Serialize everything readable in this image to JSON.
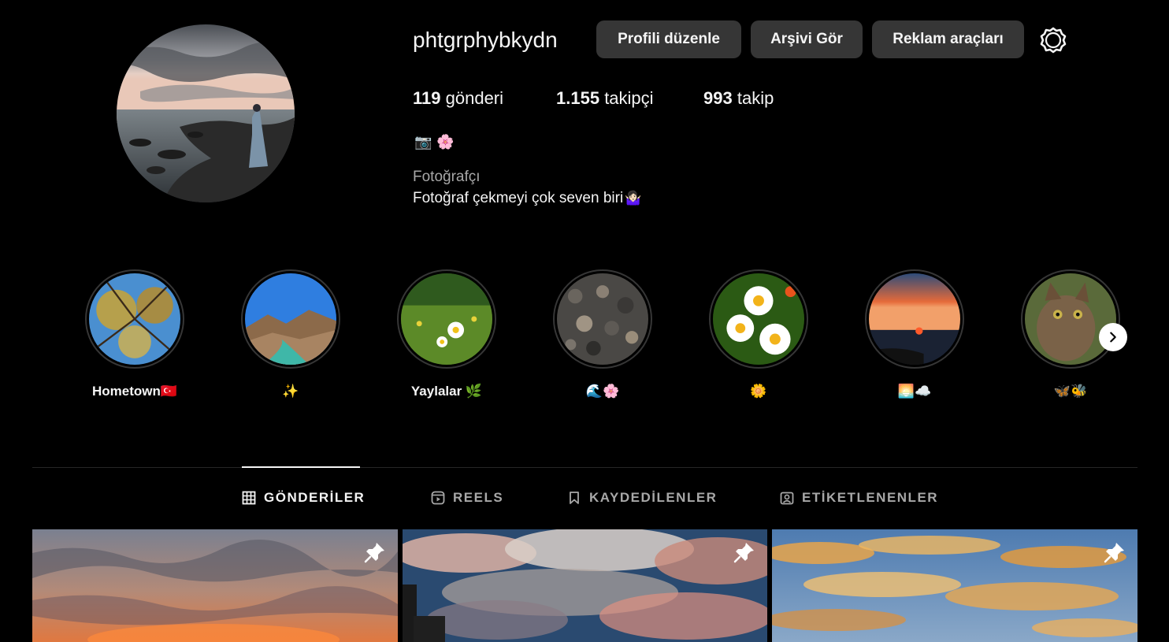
{
  "profile": {
    "username": "phtgrphybkydn",
    "buttons": {
      "edit": "Profili düzenle",
      "archive": "Arşivi Gör",
      "ads": "Reklam araçları"
    },
    "stats": {
      "posts_count": "119",
      "posts_label": "gönderi",
      "followers_count": "1.155",
      "followers_label": "takipçi",
      "following_count": "993",
      "following_label": "takip"
    },
    "bio": {
      "emojis": [
        "📷",
        "🌸"
      ],
      "category": "Fotoğrafçı",
      "text": "Fotoğraf çekmeyi çok seven biri",
      "text_emoji": "🤷🏻‍♀️"
    }
  },
  "highlights": [
    {
      "label": "Hometown🇹🇷",
      "icon": "trees-sky"
    },
    {
      "label": "✨",
      "icon": "mountain-river"
    },
    {
      "label": "Yaylalar 🌿",
      "icon": "meadow-daisies"
    },
    {
      "label": "🌊🌸",
      "icon": "pebbles"
    },
    {
      "label": "🌼",
      "icon": "daisies"
    },
    {
      "label": "🌅☁️",
      "icon": "sunset-sea"
    },
    {
      "label": "🦋🐝",
      "icon": "cat"
    }
  ],
  "tabs": [
    {
      "label": "GÖNDERİLER",
      "icon": "grid-icon",
      "active": true
    },
    {
      "label": "REELS",
      "icon": "reels-icon",
      "active": false
    },
    {
      "label": "KAYDEDİLENLER",
      "icon": "bookmark-icon",
      "active": false
    },
    {
      "label": "ETİKETLENENLER",
      "icon": "tag-icon",
      "active": false
    }
  ],
  "posts": [
    {
      "pinned": true,
      "scene": "dusk-clouds"
    },
    {
      "pinned": true,
      "scene": "dramatic-clouds-building"
    },
    {
      "pinned": true,
      "scene": "golden-clouds"
    }
  ],
  "colors": {
    "background": "#000000",
    "button": "#363636",
    "muted_text": "#a8a8a8",
    "divider": "#262626"
  }
}
